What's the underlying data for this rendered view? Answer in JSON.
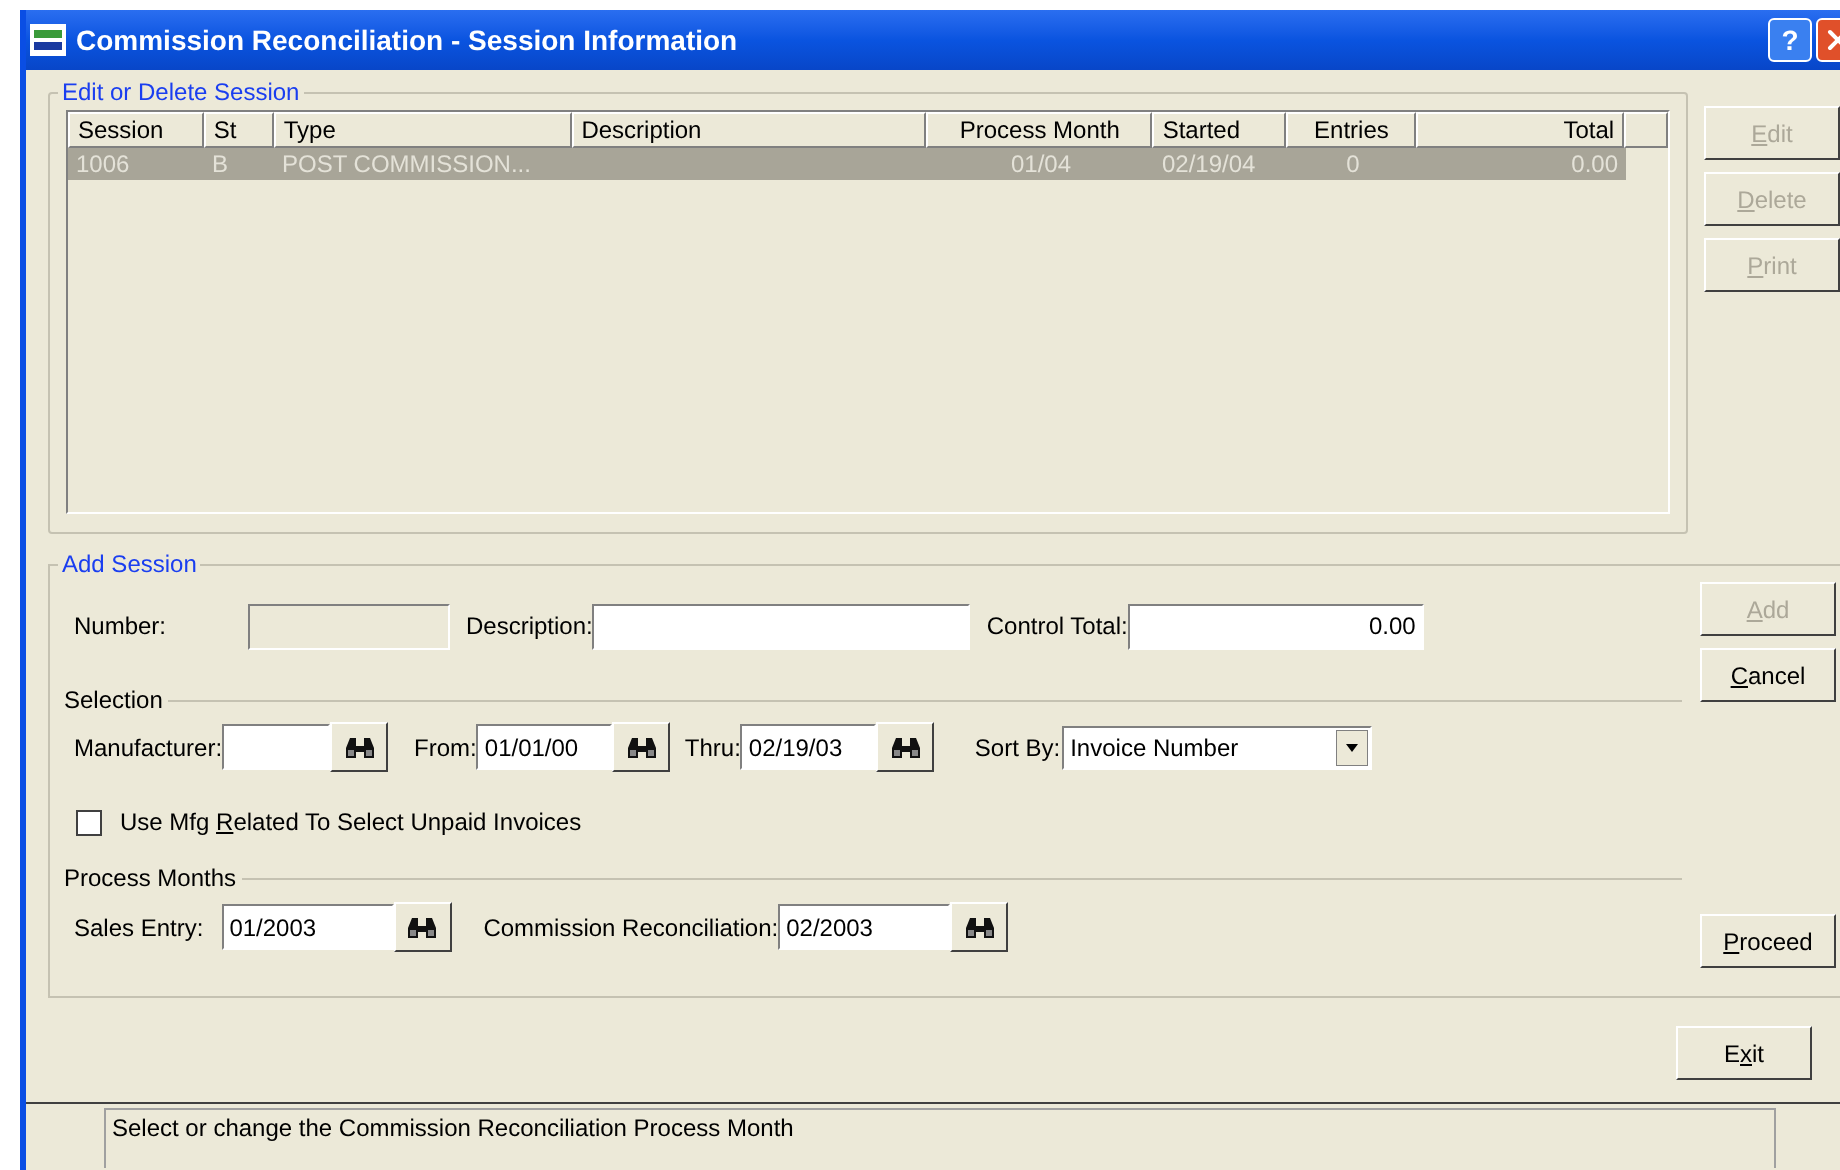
{
  "window": {
    "title": "Commission Reconciliation - Session Information",
    "help_glyph": "?"
  },
  "edit_group": {
    "title": "Edit or Delete Session",
    "columns": [
      "Session",
      "St",
      "Type",
      "Description",
      "Process Month",
      "Started",
      "Entries",
      "Total"
    ],
    "rows": [
      {
        "selected": true,
        "cells": [
          "1006",
          "B",
          "POST COMMISSION...",
          null,
          "01/04",
          "02/19/04",
          "0",
          "0.00"
        ]
      }
    ],
    "buttons": [
      {
        "label_parts": [
          {
            "text": "E",
            "underline": true
          },
          {
            "text": "dit",
            "underline": false
          }
        ],
        "disabled": true
      },
      {
        "label_parts": [
          {
            "text": "D",
            "underline": true
          },
          {
            "text": "elete",
            "underline": false
          }
        ],
        "disabled": true
      },
      {
        "label_parts": [
          {
            "text": "P",
            "underline": true
          },
          {
            "text": "rint",
            "underline": false
          }
        ],
        "disabled": true
      }
    ]
  },
  "add_group": {
    "title": "Add Session",
    "number": {
      "label": "Number:",
      "disabled": true
    },
    "description": {
      "label": "Description:"
    },
    "control_total": {
      "label": "Control Total:",
      "value": "0.00"
    },
    "buttons": [
      {
        "label_parts": [
          {
            "text": "A",
            "underline": true
          },
          {
            "text": "dd",
            "underline": false
          }
        ],
        "disabled": true
      },
      {
        "label_parts": [
          {
            "text": "C",
            "underline": true
          },
          {
            "text": "ancel",
            "underline": false
          }
        ],
        "disabled": false
      }
    ],
    "selection": {
      "title": "Selection",
      "manufacturer": {
        "label": "Manufacturer:"
      },
      "from": {
        "label": "From:",
        "value": "01/01/00"
      },
      "thru": {
        "label": "Thru:",
        "value": "02/19/03"
      },
      "sort_by": {
        "label": "Sort By:",
        "value": "Invoice Number"
      },
      "checkbox": {
        "label_parts": [
          {
            "text": "Use Mfg ",
            "underline": false
          },
          {
            "text": "R",
            "underline": true
          },
          {
            "text": "elated To Select Unpaid Invoices",
            "underline": false
          }
        ],
        "checked": false
      }
    },
    "process_months": {
      "title": "Process Months",
      "sales_entry": {
        "label": "Sales Entry:",
        "value": "01/2003"
      },
      "commission_reconciliation": {
        "label": "Commission Reconciliation:",
        "value": "02/2003"
      }
    },
    "proceed_button": {
      "label_parts": [
        {
          "text": "P",
          "underline": true
        },
        {
          "text": "roceed",
          "underline": false
        }
      ],
      "disabled": false
    }
  },
  "exit_button": {
    "label_parts": [
      {
        "text": "E",
        "underline": false
      },
      {
        "text": "x",
        "underline": true
      },
      {
        "text": "it",
        "underline": false
      }
    ],
    "disabled": false
  },
  "status_bar": {
    "text": "Select or change the Commission Reconciliation Process Month"
  }
}
